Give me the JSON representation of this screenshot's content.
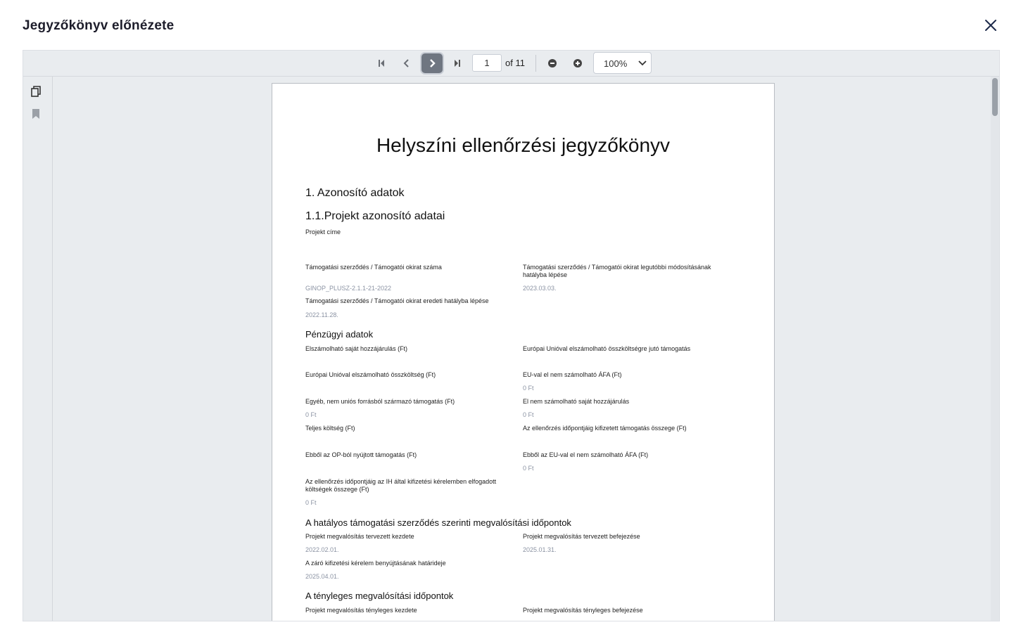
{
  "modal": {
    "title": "Jegyzőkönyv előnézete",
    "close_icon": "close-icon"
  },
  "toolbar": {
    "current_page": "1",
    "of_label": "of 11",
    "zoom": "100%"
  },
  "document": {
    "title": "Helyszíni ellenőrzési jegyzőkönyv",
    "section1": "1. Azonosító adatok",
    "section11": "1.1.Projekt azonosító adatai",
    "project_title_label": "Projekt címe",
    "contract_number_label": "Támogatási szerződés / Támogatói okirat száma",
    "contract_number_value": "GINOP_PLUSZ-2.1.1-21-2022",
    "contract_mod_label": "Támogatási szerződés / Támogatói okirat legutóbbi módosításának hatályba lépése",
    "contract_mod_value": "2023.03.03.",
    "contract_orig_label": "Támogatási szerződés / Támogatói okirat eredeti hatályba lépése",
    "contract_orig_value": "2022.11.28.",
    "financial_heading": "Pénzügyi adatok",
    "own_contribution_label": "Elszámolható saját hozzájárulás (Ft)",
    "eu_support_label": "Európai Unióval elszámolható összköltségre jutó támogatás",
    "eu_total_label": "Európai Unióval elszámolható összköltség (Ft)",
    "eu_nonvat_label": "EU-val el nem számolható ÁFA (Ft)",
    "eu_nonvat_value": "0 Ft",
    "other_support_label": "Egyéb, nem uniós forrásból származó támogatás (Ft)",
    "other_support_value": "0 Ft",
    "non_own_label": "El nem számolható saját hozzájárulás",
    "non_own_value": "0 Ft",
    "total_cost_label": "Teljes költség (Ft)",
    "paid_support_label": "Az ellenőrzés időpontjáig kifizetett támogatás összege (Ft)",
    "op_support_label": "Ebből az OP-ból nyújtott támogatás (Ft)",
    "eu_vat_label": "Ebből az EU-val el nem számolható ÁFA (Ft)",
    "eu_vat_value": "0 Ft",
    "accepted_costs_label": "Az ellenőrzés időpontjáig az IH által kifizetési kérelemben elfogadott költségek összege (Ft)",
    "accepted_costs_value": "0 Ft",
    "deadlines_heading": "A hatályos támogatási szerződés szerinti megvalósítási időpontok",
    "planned_start_label": "Projekt megvalósítás tervezett kezdete",
    "planned_start_value": "2022.02.01.",
    "planned_end_label": "Projekt megvalósítás tervezett befejezése",
    "planned_end_value": "2025.01.31.",
    "final_claim_label": "A záró kifizetési kérelem benyújtásának határideje",
    "final_claim_value": "2025.04.01.",
    "actual_heading": "A tényleges megvalósítási időpontok",
    "actual_start_label": "Projekt megvalósítás tényleges kezdete",
    "actual_end_label": "Projekt megvalósítás tényleges befejezése"
  }
}
